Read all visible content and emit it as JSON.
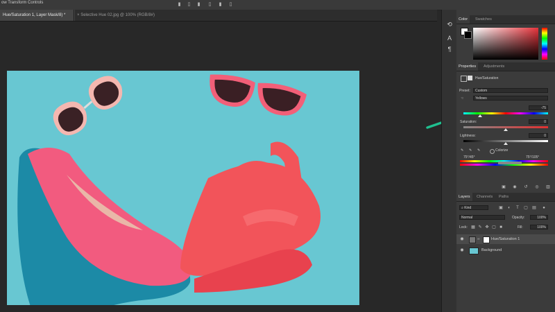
{
  "options_bar": {
    "label": "ow Transform Controls"
  },
  "tabs": [
    {
      "label": "Hue/Saturation 1, Layer Mask/8) *",
      "close": "×"
    },
    {
      "label": "Selective Hue 02.jpg @ 100% (RGB/8#)",
      "close": "×"
    }
  ],
  "color_panel": {
    "tabs": [
      "Color",
      "Swatches"
    ],
    "accent": "#e8343c"
  },
  "properties_panel": {
    "tabs": [
      "Properties",
      "Adjustments"
    ],
    "title": "Hue/Saturation",
    "preset_label": "Preset:",
    "preset_value": "Custom",
    "channel_value": "Yellows",
    "hue_value": "-75",
    "saturation_label": "Saturation:",
    "saturation_value": "0",
    "lightness_label": "Lightness:",
    "lightness_value": "0",
    "colorize_label": "Colorize",
    "range_left": "75°/45°",
    "range_right": "75°/105°"
  },
  "layers_panel": {
    "tabs": [
      "Layers",
      "Channels",
      "Paths"
    ],
    "kind_label": "Kind",
    "blend_mode": "Normal",
    "opacity_label": "Opacity:",
    "opacity_value": "100%",
    "lock_label": "Lock:",
    "fill_label": "Fill:",
    "fill_value": "100%",
    "layers": [
      {
        "name": "Hue/Saturation 1"
      },
      {
        "name": "Background"
      }
    ]
  },
  "colors": {
    "annotation_arrow": "#1fbf8f",
    "photo_bg": "#68c7d2"
  }
}
